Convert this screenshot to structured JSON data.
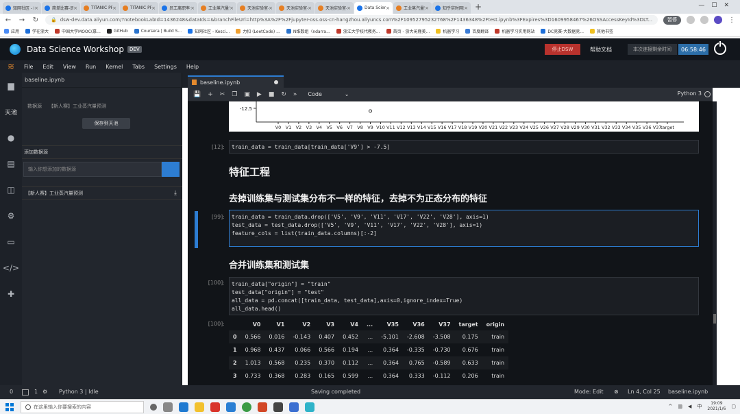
{
  "browser": {
    "tabs": [
      {
        "label": "知网社区 - Kaggle",
        "color": "#1a73e8"
      },
      {
        "label": "简单比赛-员工绩效",
        "color": "#1a73e8"
      },
      {
        "label": "TITANIC PREDICT",
        "color": "#e67e22"
      },
      {
        "label": "TITANIC PREDICT",
        "color": "#e67e22"
      },
      {
        "label": "员工离职率分析",
        "color": "#1a73e8"
      },
      {
        "label": "工业蒸汽量预测",
        "color": "#e67e22"
      },
      {
        "label": "天池实验室-Data",
        "color": "#e67e22"
      },
      {
        "label": "天池实验室-Data",
        "color": "#e67e22"
      },
      {
        "label": "天池实验室-DSW",
        "color": "#e67e22"
      },
      {
        "label": "Data Science W",
        "color": "#1a73e8",
        "active": true
      },
      {
        "label": "工业蒸汽量预测",
        "color": "#e67e22"
      },
      {
        "label": "知乎实时网站",
        "color": "#1a73e8"
      }
    ],
    "url": "dsw-dev.data.aliyun.com/?notebookLabId=1436248&dataIds=&branchFileUrl=http%3A%2F%2Fjupyter-oss.oss-cn-hangzhou.aliyuncs.com%2F10952795232768%2F1436348%2Ftest.ipynb%3FExpires%3D1609958467%26OSSAccessKeyId%3DLT...",
    "profile_label": "暂停",
    "bookmarks": [
      "应用",
      "学在浙大",
      "中国大学MOOC(慕...",
      "GitHub",
      "Coursera | Build S...",
      "知网社区 - Kesci...",
      "力扣 (LeetCode) ...",
      "N维数组（ndarra...",
      "浙江大学校代教务...",
      "首页 - 浙大闲鹿美...",
      "机器学习",
      "百度翻译",
      "机器学习实用网站",
      "DC竞赛-大数据竞...",
      "其他书签"
    ]
  },
  "app": {
    "title": "Data Science Workshop",
    "badge": "DEV",
    "stop_button": "停止DSW",
    "docs_button": "帮助文档",
    "conn_label": "本次连接剩余时间",
    "conn_time": "06:58:46"
  },
  "activity": [
    "folder-icon",
    "天池",
    "circle-icon",
    "database-icon",
    "kernel-icon",
    "tools-icon",
    "window-icon",
    "code-icon",
    "puzzle-icon"
  ],
  "menu": [
    "File",
    "Edit",
    "View",
    "Run",
    "Kernel",
    "Tabs",
    "Settings",
    "Help"
  ],
  "panel": {
    "file": "baseline.ipynb",
    "ds_label": "数据源",
    "ds_name": "【新人赛】工业蒸汽量预测",
    "save_button": "保存到天池",
    "add_ds": "添加数据源",
    "ds_placeholder": "输入你想添加的数据源",
    "ds_item": "【新人赛】工业蒸汽量预测"
  },
  "notebook": {
    "tab": "baseline.ipynb",
    "cell_type": "Code",
    "kernel": "Python 3"
  },
  "plot": {
    "ytick": "-12.5",
    "xticks": [
      "V0",
      "V1",
      "V2",
      "V3",
      "V4",
      "V5",
      "V6",
      "V7",
      "V8",
      "V9",
      "V10",
      "V11",
      "V12",
      "V13",
      "V14",
      "V15",
      "V16",
      "V17",
      "V18",
      "V19",
      "V20",
      "V21",
      "V22",
      "V23",
      "V24",
      "V25",
      "V26",
      "V27",
      "V28",
      "V29",
      "V30",
      "V31",
      "V32",
      "V33",
      "V34",
      "V35",
      "V36",
      "V37",
      "target"
    ],
    "outlier_category": "V9"
  },
  "cells": {
    "c12_prompt": "[12]:",
    "c12_code": "train_data = train_data[train_data['V9'] > -7.5]",
    "h1": "特征工程",
    "h2a": "去掉训练集与测试集分布不一样的特征，去掉不为正态分布的特征",
    "c99_prompt": "[99]:",
    "c99_l1": "train_data = train_data.drop(['V5', 'V9', 'V11', 'V17', 'V22', 'V28'], axis=1)",
    "c99_l2": "test_data = test_data.drop(['V5', 'V9', 'V11', 'V17', 'V22', 'V28'], axis=1)",
    "c99_l3": "",
    "c99_l4": "feature_cols = list(train_data.columns)[:-2]",
    "h2b": "合并训练集和测试集",
    "c100_prompt": "[100]:",
    "c100_l1": "train_data[\"origin\"] = \"train\"",
    "c100_l2": "test_data[\"origin\"] = \"test\"",
    "c100_l3": "all_data = pd.concat([train_data, test_data],axis=0,ignore_index=True)",
    "c100_l4": "all_data.head()",
    "out100_prompt": "[100]:"
  },
  "table": {
    "columns": [
      "",
      "V0",
      "V1",
      "V2",
      "V3",
      "V4",
      "...",
      "V35",
      "V36",
      "V37",
      "target",
      "origin"
    ],
    "rows": [
      [
        "0",
        "0.566",
        "0.016",
        "-0.143",
        "0.407",
        "0.452",
        "...",
        "-5.101",
        "-2.608",
        "-3.508",
        "0.175",
        "train"
      ],
      [
        "1",
        "0.968",
        "0.437",
        "0.066",
        "0.566",
        "0.194",
        "...",
        "0.364",
        "-0.335",
        "-0.730",
        "0.676",
        "train"
      ],
      [
        "2",
        "1.013",
        "0.568",
        "0.235",
        "0.370",
        "0.112",
        "...",
        "0.364",
        "0.765",
        "-0.589",
        "0.633",
        "train"
      ],
      [
        "3",
        "0.733",
        "0.368",
        "0.283",
        "0.165",
        "0.599",
        "...",
        "0.364",
        "0.333",
        "-0.112",
        "0.206",
        "train"
      ]
    ]
  },
  "status": {
    "n1": "0",
    "n2": "1",
    "kernel": "Python 3 | Idle",
    "saving": "Saving completed",
    "mode": "Mode: Edit",
    "position": "Ln 4, Col 25",
    "file": "baseline.ipynb"
  },
  "taskbar": {
    "search_placeholder": "在这里输入你要搜索的内容",
    "ime": "中",
    "time": "19:09",
    "date": "2021/1/6"
  }
}
